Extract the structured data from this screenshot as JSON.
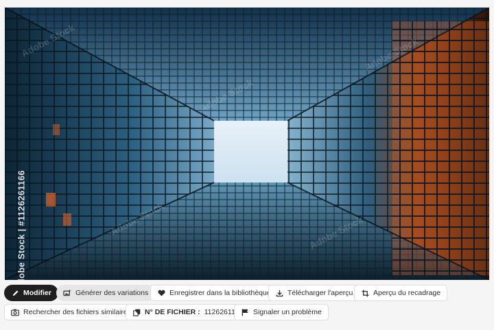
{
  "image": {
    "watermark_vertical": "Adobe Stock | #1126261166",
    "watermark_diagonal": "Adobe Stock"
  },
  "actions_row1": {
    "edit_label": "Modifier",
    "variations_label": "Générer des variations",
    "save_library_label": "Enregistrer dans la bibliothèque",
    "download_preview_label": "Télécharger l'aperçu",
    "crop_preview_label": "Aperçu du recadrage"
  },
  "actions_row2": {
    "find_similar_label": "Rechercher des fichiers similaires",
    "file_number_prefix": "N° DE FICHIER :",
    "file_number_value": "1126261166",
    "report_label": "Signaler un problème"
  },
  "colors": {
    "dark_button": "#1f1f1f",
    "glass_blue": "#3f7fa3",
    "warm_orange": "#e0642a",
    "sky": "#dceaf5"
  }
}
